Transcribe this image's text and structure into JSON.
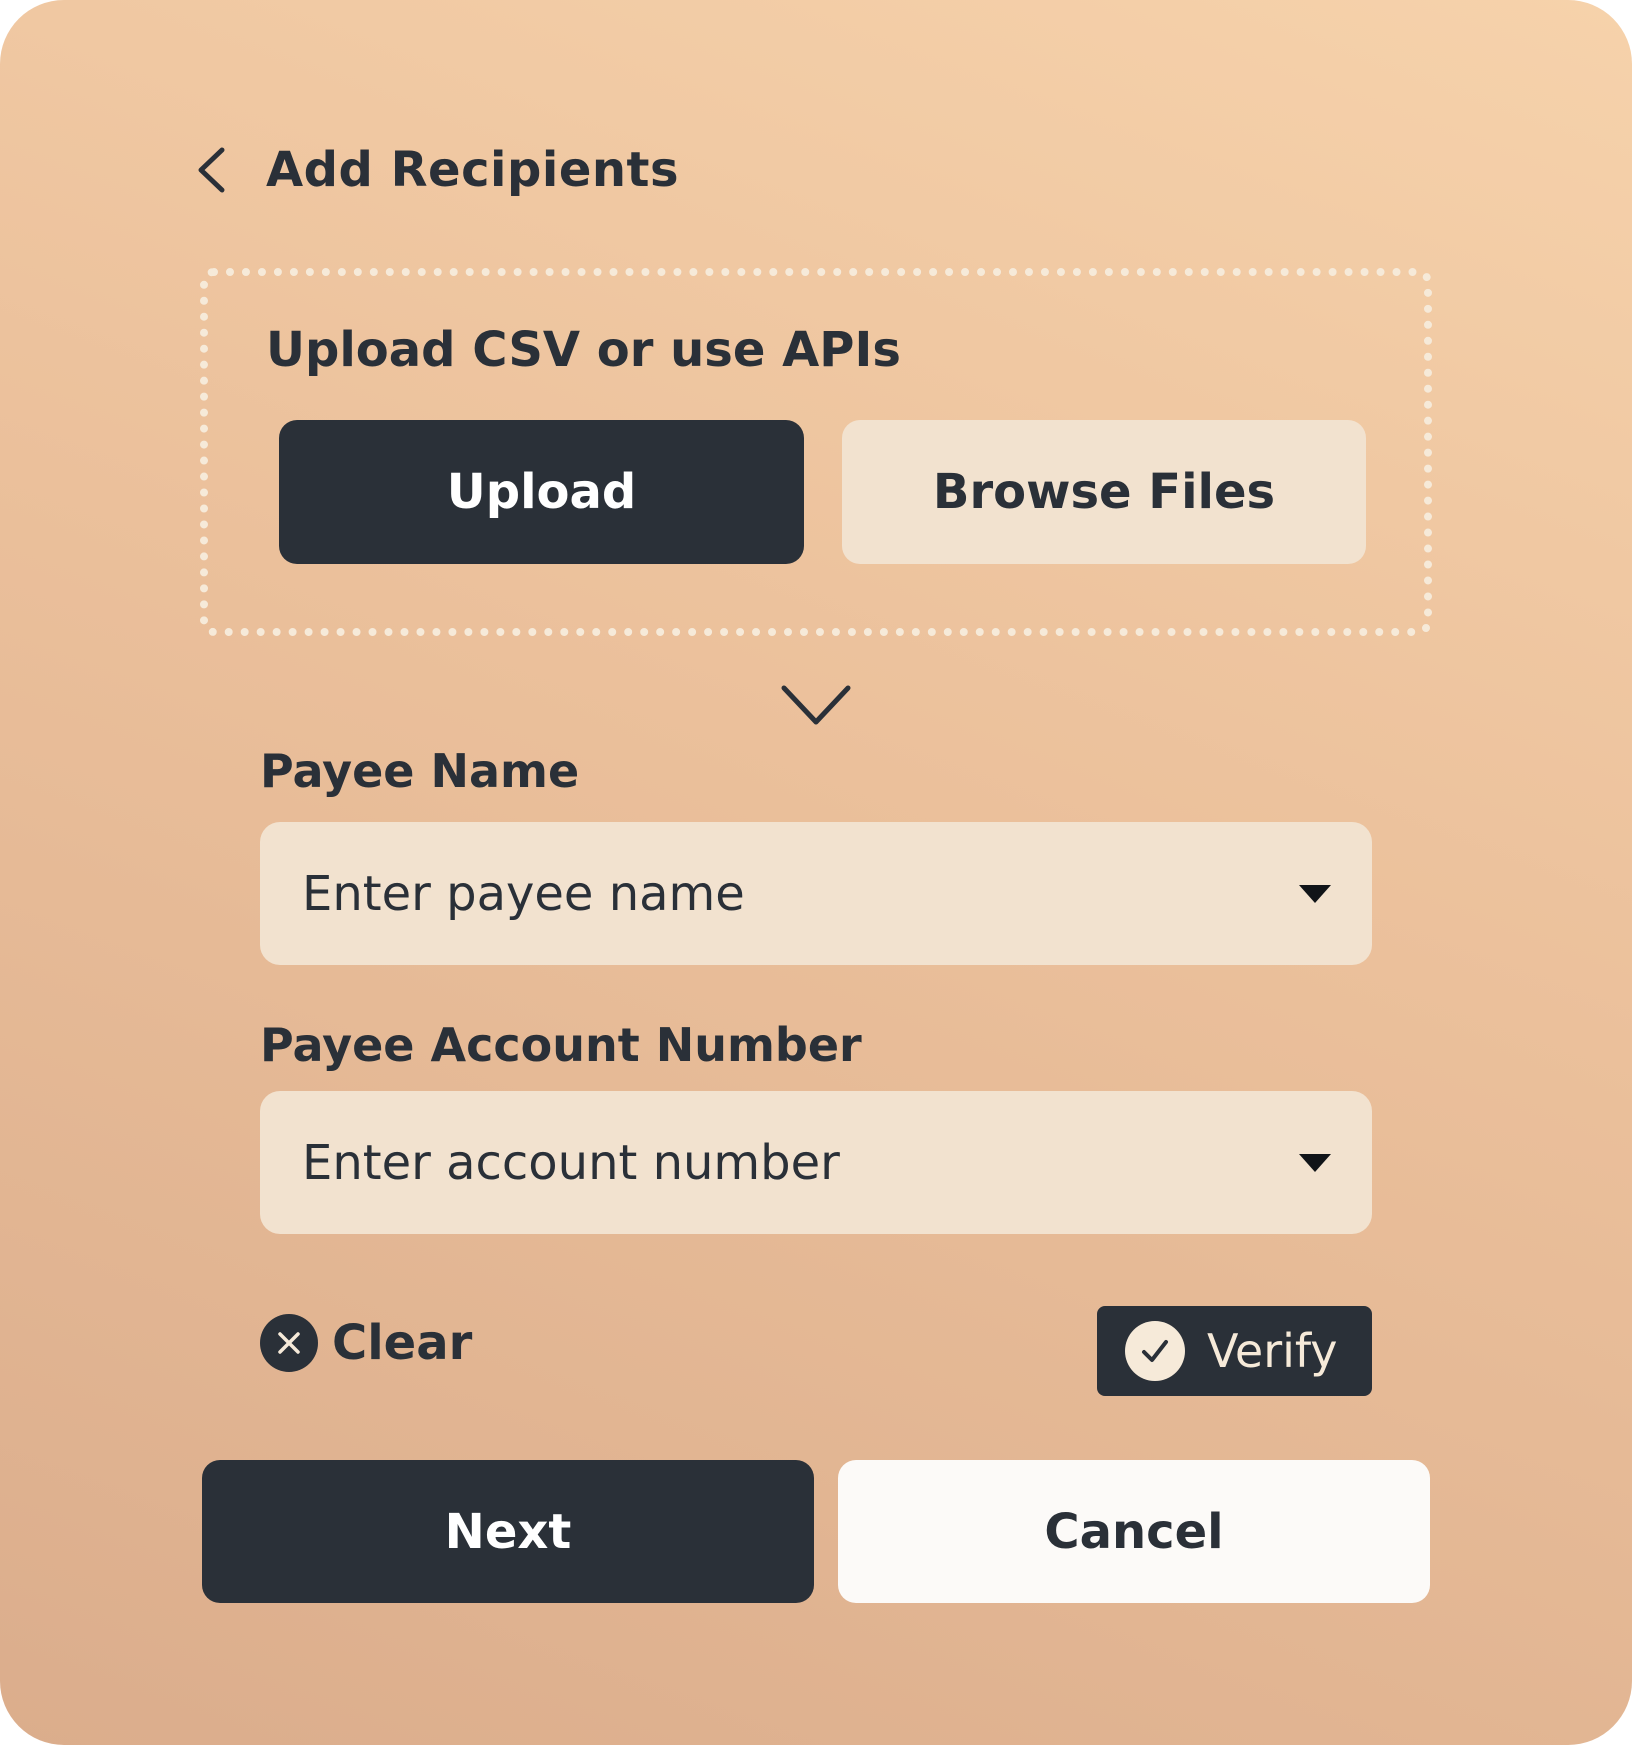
{
  "header": {
    "title": "Add Recipients",
    "back_icon": "chevron-left-icon"
  },
  "upload": {
    "heading": "Upload CSV or use APIs",
    "upload_label": "Upload",
    "browse_label": "Browse Files"
  },
  "divider": {
    "icon": "chevron-down-icon"
  },
  "form": {
    "payee_name": {
      "label": "Payee Name",
      "placeholder": "Enter payee name"
    },
    "account_number": {
      "label": "Payee Account Number",
      "placeholder": "Enter account number"
    }
  },
  "actions": {
    "clear_label": "Clear",
    "verify_label": "Verify",
    "next_label": "Next",
    "cancel_label": "Cancel"
  },
  "colors": {
    "dark": "#2a3038",
    "light_fill": "#f2e2cf",
    "card_gradient_top": "#f6d2ab",
    "card_gradient_bottom": "#dbad8c",
    "white": "#fcfaf8"
  }
}
